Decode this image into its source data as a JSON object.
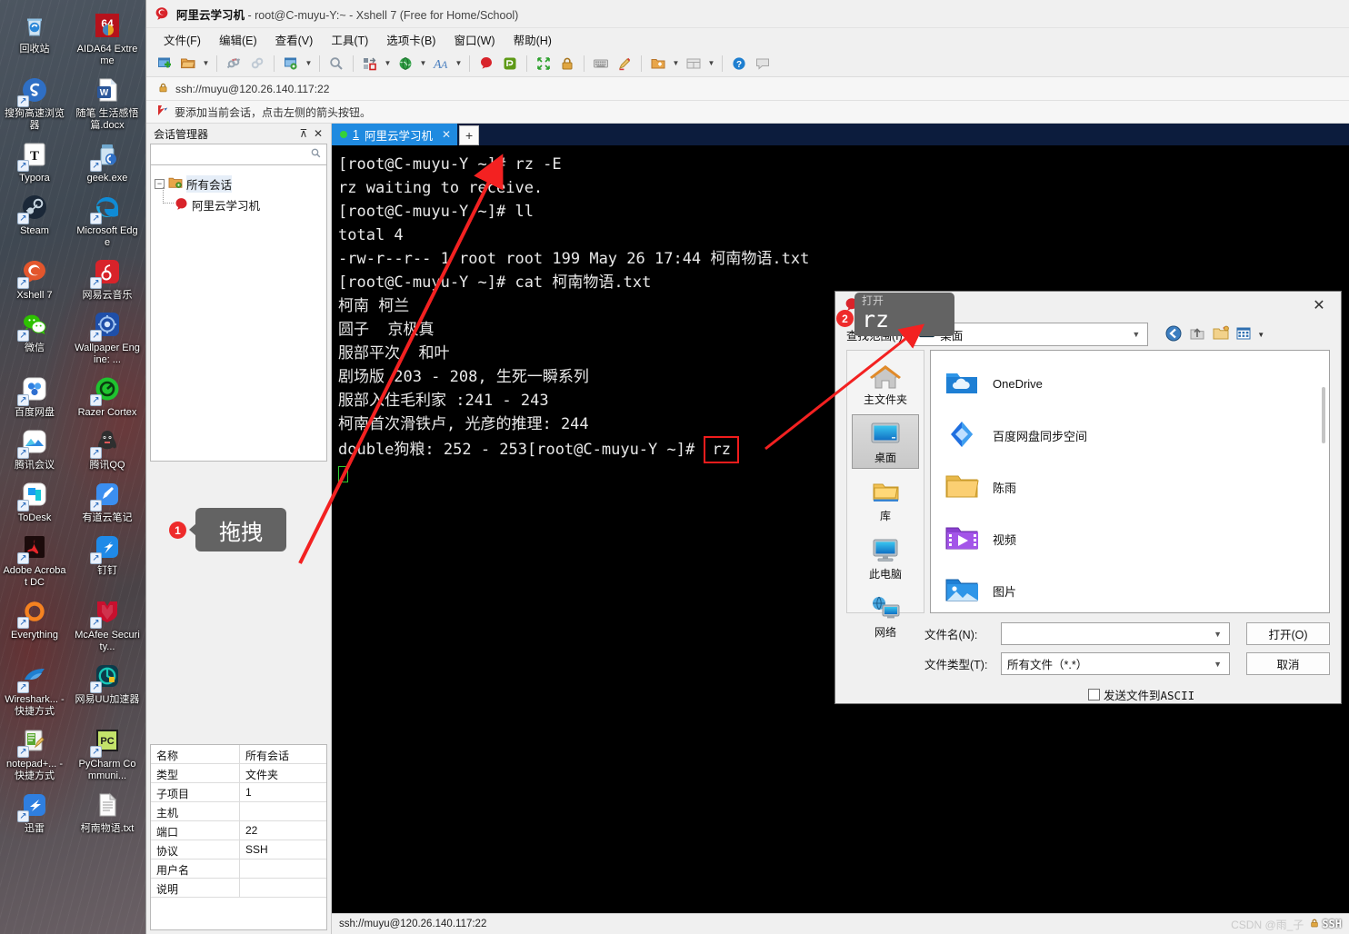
{
  "desktop": {
    "icons": [
      {
        "label": "回收站",
        "icon": "recycle-bin-icon",
        "shortcut": false
      },
      {
        "label": "AIDA64 Extreme",
        "icon": "aida64-icon",
        "shortcut": false
      },
      {
        "label": "搜狗高速浏览器",
        "icon": "sogou-browser-icon",
        "shortcut": true
      },
      {
        "label": "随笔 生活感悟篇.docx",
        "icon": "word-document-icon",
        "shortcut": false
      },
      {
        "label": "Typora",
        "icon": "typora-icon",
        "shortcut": true
      },
      {
        "label": "geek.exe",
        "icon": "geek-uninstaller-icon",
        "shortcut": true
      },
      {
        "label": "Steam",
        "icon": "steam-icon",
        "shortcut": true
      },
      {
        "label": "Microsoft Edge",
        "icon": "edge-icon",
        "shortcut": true
      },
      {
        "label": "Xshell 7",
        "icon": "xshell-icon",
        "shortcut": true
      },
      {
        "label": "网易云音乐",
        "icon": "netease-music-icon",
        "shortcut": true
      },
      {
        "label": "微信",
        "icon": "wechat-icon",
        "shortcut": true
      },
      {
        "label": "Wallpaper Engine: ...",
        "icon": "wallpaper-engine-icon",
        "shortcut": true
      },
      {
        "label": "百度网盘",
        "icon": "baidu-netdisk-icon",
        "shortcut": true
      },
      {
        "label": "Razer Cortex",
        "icon": "razer-cortex-icon",
        "shortcut": true
      },
      {
        "label": "腾讯会议",
        "icon": "tencent-meeting-icon",
        "shortcut": true
      },
      {
        "label": "腾讯QQ",
        "icon": "tencent-qq-icon",
        "shortcut": true
      },
      {
        "label": "ToDesk",
        "icon": "todesk-icon",
        "shortcut": true
      },
      {
        "label": "有道云笔记",
        "icon": "youdao-note-icon",
        "shortcut": true
      },
      {
        "label": "Adobe Acrobat DC",
        "icon": "adobe-acrobat-icon",
        "shortcut": true
      },
      {
        "label": "钉钉",
        "icon": "dingtalk-icon",
        "shortcut": true
      },
      {
        "label": "Everything",
        "icon": "everything-icon",
        "shortcut": true
      },
      {
        "label": "McAfee Security...",
        "icon": "mcafee-icon",
        "shortcut": true
      },
      {
        "label": "Wireshark... - 快捷方式",
        "icon": "wireshark-icon",
        "shortcut": true
      },
      {
        "label": "网易UU加速器",
        "icon": "uu-booster-icon",
        "shortcut": true
      },
      {
        "label": "notepad+... - 快捷方式",
        "icon": "notepadpp-icon",
        "shortcut": true
      },
      {
        "label": "PyCharm Communi...",
        "icon": "pycharm-icon",
        "shortcut": true
      },
      {
        "label": "迅雷",
        "icon": "thunder-icon",
        "shortcut": true
      },
      {
        "label": "柯南物语.txt",
        "icon": "text-file-icon",
        "shortcut": false
      }
    ]
  },
  "window": {
    "title_session": "阿里云学习机",
    "title_rest": " - root@C-muyu-Y:~ - Xshell 7 (Free for Home/School)",
    "app_icon": "xshell-logo-icon",
    "menus": [
      "文件(F)",
      "编辑(E)",
      "查看(V)",
      "工具(T)",
      "选项卡(B)",
      "窗口(W)",
      "帮助(H)"
    ],
    "toolbar_buttons": [
      "new-session-icon",
      "open-session-icon",
      "open-dropdown-caret",
      "disconnect-icon",
      "reconnect-icon",
      "session-properties-icon",
      "properties-dropdown-caret",
      "find-icon",
      "layout-icon",
      "layout-dropdown-caret",
      "globe-icon",
      "globe-dropdown-caret",
      "font-icon",
      "font-dropdown-caret",
      "xshell-quick-icon",
      "xftp-icon",
      "fullscreen-icon",
      "lock-icon",
      "keyboard-icon",
      "highlight-pen-icon",
      "add-folder-icon",
      "add-folder-caret",
      "split-view-icon",
      "split-view-caret",
      "help-icon",
      "feedback-icon"
    ],
    "address": "ssh://muyu@120.26.140.117:22",
    "address_icon": "lock-icon",
    "tip_icon": "red-arrow-icon",
    "tip_text": "要添加当前会话，点击左侧的箭头按钮。"
  },
  "session_manager": {
    "header": "会话管理器",
    "pin_icon": "pin-icon",
    "close_icon": "close-icon",
    "search_placeholder": "",
    "search_icon": "search-icon",
    "tree": {
      "root_label": "所有会话",
      "root_icon": "folder-gear-icon",
      "child_label": "阿里云学习机",
      "child_icon": "xshell-logo-icon"
    },
    "properties": [
      {
        "key": "名称",
        "value": "所有会话"
      },
      {
        "key": "类型",
        "value": "文件夹"
      },
      {
        "key": "子项目",
        "value": "1"
      },
      {
        "key": "主机",
        "value": ""
      },
      {
        "key": "端口",
        "value": "22"
      },
      {
        "key": "协议",
        "value": "SSH"
      },
      {
        "key": "用户名",
        "value": ""
      },
      {
        "key": "说明",
        "value": ""
      }
    ]
  },
  "tabs": {
    "active": {
      "index": "1",
      "label": "阿里云学习机",
      "close_icon": "close-icon",
      "status_icon": "connected-dot-icon"
    },
    "new_tab_icon": "plus-icon"
  },
  "terminal": {
    "lines": [
      "[root@C-muyu-Y ~]# rz -E",
      "rz waiting to receive.",
      "[root@C-muyu-Y ~]# ll",
      "total 4",
      "-rw-r--r-- 1 root root 199 May 26 17:44 柯南物语.txt",
      "[root@C-muyu-Y ~]# cat 柯南物语.txt",
      "柯南 柯兰",
      "圆子  京极真",
      "服部平次  和叶",
      "剧场版 203 - 208, 生死一瞬系列",
      "服部入住毛利家 :241 - 243",
      "柯南首次滑铁卢, 光彦的推理: 244"
    ],
    "last_line_prefix": "double狗粮: 252 - 253[root@C-muyu-Y ~]# ",
    "highlighted_command": "rz",
    "cursor": "block-cursor"
  },
  "statusbar": {
    "text": "ssh://muyu@120.26.140.117:22",
    "watermark": "CSDN @雨_子",
    "ssh_label": "SSH",
    "ssh_icon": "lock-icon"
  },
  "open_dialog": {
    "title": "打开",
    "title_icon": "xshell-logo-icon",
    "close_icon": "close-icon",
    "lookin_label": "查找范围(I):",
    "lookin_value": "桌面",
    "lookin_icon": "desktop-icon",
    "nav_buttons": [
      "back-icon",
      "up-folder-icon",
      "new-folder-icon",
      "view-mode-icon",
      "view-mode-caret"
    ],
    "places": [
      {
        "label": "主文件夹",
        "icon": "home-folder-icon",
        "active": false
      },
      {
        "label": "桌面",
        "icon": "desktop-icon",
        "active": true
      },
      {
        "label": "库",
        "icon": "library-folder-icon",
        "active": false
      },
      {
        "label": "此电脑",
        "icon": "this-pc-icon",
        "active": false
      },
      {
        "label": "网络",
        "icon": "network-icon",
        "active": false
      }
    ],
    "files": [
      {
        "name": "OneDrive",
        "icon": "onedrive-icon"
      },
      {
        "name": "百度网盘同步空间",
        "icon": "baidu-sync-icon"
      },
      {
        "name": "陈雨",
        "icon": "folder-icon"
      },
      {
        "name": "视频",
        "icon": "videos-folder-icon"
      },
      {
        "name": "图片",
        "icon": "pictures-folder-icon"
      }
    ],
    "filename_label": "文件名(N):",
    "filename_value": "",
    "filetype_label": "文件类型(T):",
    "filetype_value": "所有文件（*.*）",
    "open_button": "打开(O)",
    "cancel_button": "取消",
    "ascii_checkbox_label": "发送文件到ASCII",
    "ascii_checked": false
  },
  "tooltip": {
    "title": "打开",
    "text": "rz"
  },
  "annotations": [
    {
      "number": "1",
      "label": "拖拽"
    },
    {
      "number": "2",
      "label": ""
    }
  ],
  "colors": {
    "accent_blue": "#1f8ae0",
    "annotation_red": "#ee2b2b",
    "terminal_bg": "#000000",
    "terminal_fg": "#e9e9e9",
    "cursor_green": "#2ecb2e"
  }
}
